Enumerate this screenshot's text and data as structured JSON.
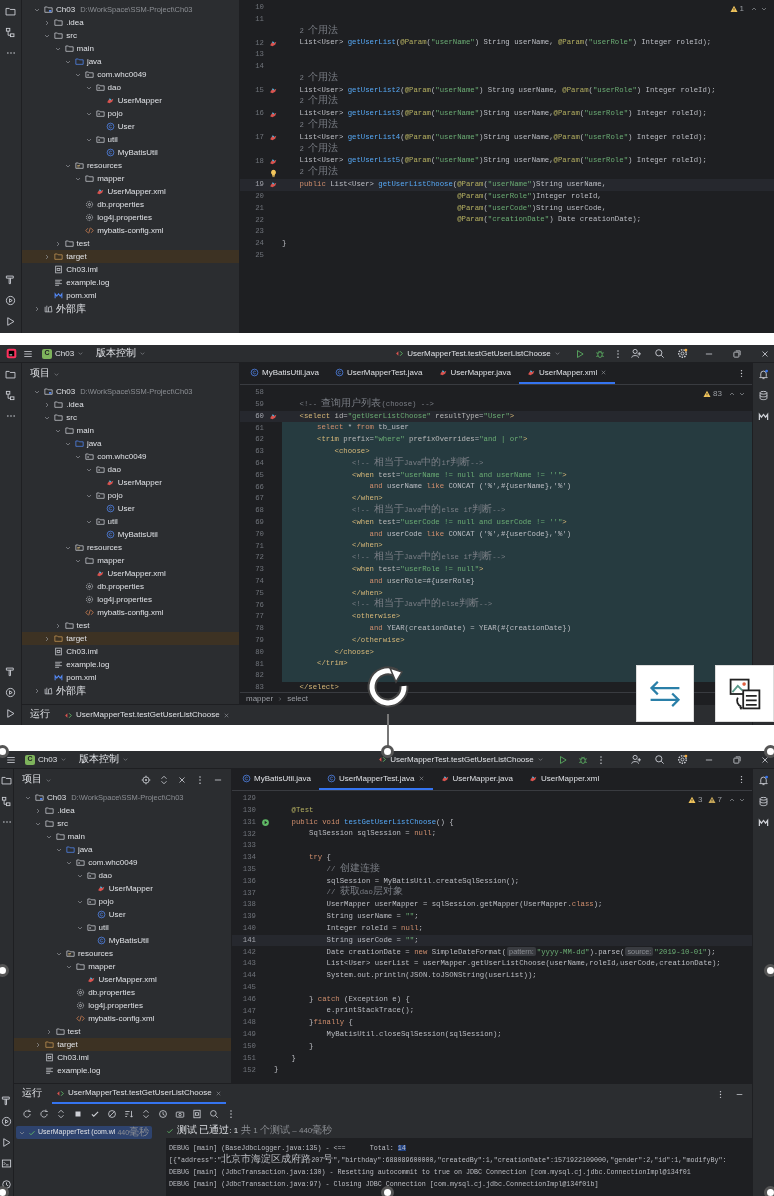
{
  "panels": [
    {
      "tree": [
        {
          "label": "Ch03",
          "path": "D:\\WorkSpace\\SSM-Project\\Ch03",
          "kind": "module",
          "expanded": true,
          "children": [
            {
              "label": ".idea",
              "kind": "folder",
              "expanded": false
            },
            {
              "label": "src",
              "kind": "folder",
              "expanded": true,
              "children": [
                {
                  "label": "main",
                  "kind": "folder",
                  "expanded": true,
                  "children": [
                    {
                      "label": "java",
                      "kind": "source-folder",
                      "expanded": true,
                      "children": [
                        {
                          "label": "com.whc0049",
                          "kind": "package",
                          "expanded": true,
                          "children": [
                            {
                              "label": "dao",
                              "kind": "package",
                              "expanded": true,
                              "children": [
                                {
                                  "label": "UserMapper",
                                  "kind": "mapper-interface"
                                }
                              ]
                            },
                            {
                              "label": "pojo",
                              "kind": "package",
                              "expanded": true,
                              "children": [
                                {
                                  "label": "User",
                                  "kind": "class"
                                }
                              ]
                            },
                            {
                              "label": "util",
                              "kind": "package",
                              "expanded": true,
                              "children": [
                                {
                                  "label": "MyBatisUtil",
                                  "kind": "class"
                                }
                              ]
                            }
                          ]
                        }
                      ]
                    },
                    {
                      "label": "resources",
                      "kind": "resources-folder",
                      "expanded": true,
                      "children": [
                        {
                          "label": "mapper",
                          "kind": "folder",
                          "expanded": true,
                          "children": [
                            {
                              "label": "UserMapper.xml",
                              "kind": "mapper-xml"
                            }
                          ]
                        },
                        {
                          "label": "db.properties",
                          "kind": "properties"
                        },
                        {
                          "label": "log4j.properties",
                          "kind": "properties"
                        },
                        {
                          "label": "mybatis-config.xml",
                          "kind": "xml"
                        }
                      ]
                    }
                  ]
                },
                {
                  "label": "test",
                  "kind": "folder",
                  "expanded": false
                }
              ]
            },
            {
              "label": "target",
              "kind": "excluded-folder",
              "expanded": false
            },
            {
              "label": "Ch03.iml",
              "kind": "iml"
            },
            {
              "label": "example.log",
              "kind": "log"
            },
            {
              "label": "pom.xml",
              "kind": "maven"
            }
          ]
        },
        {
          "label": "外部库",
          "kind": "library",
          "expanded": false
        }
      ],
      "editor": {
        "warnings": [
          {
            "kind": "warning",
            "count": "1"
          }
        ],
        "lines": [
          {
            "n": "10",
            "kind": "code"
          },
          {
            "n": "11",
            "kind": "code"
          },
          {
            "kind": "hint",
            "text": "    2 个用法"
          },
          {
            "n": "12",
            "kind": "code",
            "gutter": {
              "kind": "mapper"
            },
            "text": "    List<User> getUserList(@Param(\"userName\") String userName, @Param(\"userRole\") Integer roleId);"
          },
          {
            "n": "13",
            "kind": "code"
          },
          {
            "n": "14",
            "kind": "code"
          },
          {
            "kind": "hint",
            "text": "    2 个用法"
          },
          {
            "n": "15",
            "kind": "code",
            "gutter": {
              "kind": "mapper"
            },
            "text": "    List<User> getUserList2(@Param(\"userName\") String userName, @Param(\"userRole\") Integer roleId);"
          },
          {
            "kind": "hint",
            "text": "    2 个用法"
          },
          {
            "n": "16",
            "kind": "code",
            "gutter": {
              "kind": "mapper"
            },
            "text": "    List<User> getUserList3(@Param(\"userName\")String userName,@Param(\"userRole\") Integer roleId);"
          },
          {
            "kind": "hint",
            "text": "    2 个用法"
          },
          {
            "n": "17",
            "kind": "code",
            "gutter": {
              "kind": "mapper"
            },
            "text": "    List<User> getUserList4(@Param(\"userName\")String userName,@Param(\"userRole\") Integer roleId);"
          },
          {
            "kind": "hint",
            "text": "    2 个用法"
          },
          {
            "n": "18",
            "kind": "code",
            "gutter": {
              "kind": "mapper"
            },
            "text": "    List<User> getUserList5(@Param(\"userName\")String userName,@Param(\"userRole\") Integer roleId);"
          },
          {
            "kind": "hint",
            "gutter": {
              "kind": "bulb"
            },
            "text": "    2 个用法"
          },
          {
            "n": "19",
            "kind": "current",
            "gutter": {
              "kind": "mapper"
            },
            "text": "    public List<User> getUserListChoose(@Param(\"userName\")String userName,"
          },
          {
            "n": "20",
            "kind": "code",
            "text": "                                        @Param(\"userRole\")Integer roleId,"
          },
          {
            "n": "21",
            "kind": "code",
            "text": "                                        @Param(\"userCode\")String userCode,"
          },
          {
            "n": "22",
            "kind": "code",
            "text": "                                        @Param(\"creationDate\") Date creationDate);"
          },
          {
            "n": "23",
            "kind": "code"
          },
          {
            "n": "24",
            "kind": "code",
            "text": "}"
          },
          {
            "n": "25",
            "kind": "code"
          }
        ]
      }
    },
    {
      "titlebar": {
        "logo": true,
        "project_initial": "C",
        "project": "Ch03",
        "vcs": "版本控制",
        "run_config": "UserMapperTest.testGetUserListChoose"
      },
      "pane_title": "项目",
      "tree": [
        {
          "label": "Ch03",
          "path": "D:\\WorkSpace\\SSM-Project\\Ch03",
          "kind": "module",
          "expanded": true,
          "children": [
            {
              "label": ".idea",
              "kind": "folder",
              "expanded": false
            },
            {
              "label": "src",
              "kind": "folder",
              "expanded": true,
              "children": [
                {
                  "label": "main",
                  "kind": "folder",
                  "expanded": true,
                  "children": [
                    {
                      "label": "java",
                      "kind": "source-folder",
                      "expanded": true,
                      "children": [
                        {
                          "label": "com.whc0049",
                          "kind": "package",
                          "expanded": true,
                          "children": [
                            {
                              "label": "dao",
                              "kind": "package",
                              "expanded": true,
                              "children": [
                                {
                                  "label": "UserMapper",
                                  "kind": "mapper-interface"
                                }
                              ]
                            },
                            {
                              "label": "pojo",
                              "kind": "package",
                              "expanded": true,
                              "children": [
                                {
                                  "label": "User",
                                  "kind": "class"
                                }
                              ]
                            },
                            {
                              "label": "util",
                              "kind": "package",
                              "expanded": true,
                              "children": [
                                {
                                  "label": "MyBatisUtil",
                                  "kind": "class"
                                }
                              ]
                            }
                          ]
                        }
                      ]
                    },
                    {
                      "label": "resources",
                      "kind": "resources-folder",
                      "expanded": true,
                      "children": [
                        {
                          "label": "mapper",
                          "kind": "folder",
                          "expanded": true,
                          "children": [
                            {
                              "label": "UserMapper.xml",
                              "kind": "mapper-xml"
                            }
                          ]
                        },
                        {
                          "label": "db.properties",
                          "kind": "properties"
                        },
                        {
                          "label": "log4j.properties",
                          "kind": "properties"
                        },
                        {
                          "label": "mybatis-config.xml",
                          "kind": "xml"
                        }
                      ]
                    }
                  ]
                },
                {
                  "label": "test",
                  "kind": "folder",
                  "expanded": false
                }
              ]
            },
            {
              "label": "target",
              "kind": "excluded-folder",
              "expanded": false
            },
            {
              "label": "Ch03.iml",
              "kind": "iml"
            },
            {
              "label": "example.log",
              "kind": "log"
            },
            {
              "label": "pom.xml",
              "kind": "maven"
            }
          ]
        },
        {
          "label": "外部库",
          "kind": "library",
          "expanded": false
        }
      ],
      "editor": {
        "tabs": [
          {
            "label": "MyBatisUtil.java",
            "kind": "class",
            "selected": false
          },
          {
            "label": "UserMapperTest.java",
            "kind": "class",
            "selected": false
          },
          {
            "label": "UserMapper.java",
            "kind": "mapper-interface",
            "selected": false
          },
          {
            "label": "UserMapper.xml",
            "kind": "mapper-xml",
            "selected": true
          }
        ],
        "warnings": [
          {
            "kind": "warning",
            "count": "83"
          }
        ],
        "lines": [
          {
            "n": "58",
            "kind": "code"
          },
          {
            "n": "59",
            "kind": "code",
            "text": "    <!-- 查询用户列表(choose) -->"
          },
          {
            "n": "60",
            "kind": "current",
            "gutter": {
              "kind": "mapper"
            },
            "text": "    <select id=\"getUserListChoose\" resultType=\"User\">"
          },
          {
            "n": "61",
            "kind": "injected",
            "text": "        select * from tb_user"
          },
          {
            "n": "62",
            "kind": "injected",
            "text": "        <trim prefix=\"where\" prefixOverrides=\"and | or\">"
          },
          {
            "n": "63",
            "kind": "injected",
            "text": "            <choose>"
          },
          {
            "n": "64",
            "kind": "injected",
            "text": "                <!-- 相当于Java中的if判断-->"
          },
          {
            "n": "65",
            "kind": "injected",
            "text": "                <when test=\"userName != null and userName != ''\">"
          },
          {
            "n": "66",
            "kind": "injected",
            "text": "                    and userName like CONCAT ('%',#{userName},'%')"
          },
          {
            "n": "67",
            "kind": "injected",
            "text": "                </when>"
          },
          {
            "n": "68",
            "kind": "injected",
            "text": "                <!-- 相当于Java中的else if判断-->"
          },
          {
            "n": "69",
            "kind": "injected",
            "text": "                <when test=\"userCode != null and userCode != ''\">"
          },
          {
            "n": "70",
            "kind": "injected",
            "text": "                    and userCode like CONCAT ('%',#{userCode},'%')"
          },
          {
            "n": "71",
            "kind": "injected",
            "text": "                </when>"
          },
          {
            "n": "72",
            "kind": "injected",
            "text": "                <!-- 相当于Java中的else if判断-->"
          },
          {
            "n": "73",
            "kind": "injected",
            "text": "                <when test=\"userRole != null\">"
          },
          {
            "n": "74",
            "kind": "injected",
            "text": "                    and userRole=#{userRole}"
          },
          {
            "n": "75",
            "kind": "injected",
            "text": "                </when>"
          },
          {
            "n": "76",
            "kind": "injected",
            "text": "                <!-- 相当于Java中的else判断-->"
          },
          {
            "n": "77",
            "kind": "injected",
            "text": "                <otherwise>"
          },
          {
            "n": "78",
            "kind": "injected",
            "text": "                    and YEAR(creationDate) = YEAR(#{creationDate})"
          },
          {
            "n": "79",
            "kind": "injected",
            "text": "                </otherwise>"
          },
          {
            "n": "80",
            "kind": "injected",
            "text": "            </choose>"
          },
          {
            "n": "81",
            "kind": "injected",
            "text": "        </trim>"
          },
          {
            "n": "82",
            "kind": "injected"
          },
          {
            "n": "83",
            "kind": "code",
            "text": "    </select>"
          }
        ],
        "breadcrumb": [
          "mapper",
          "select"
        ]
      },
      "run": {
        "label": "运行",
        "tab": "UserMapperTest.testGetUserListChoose"
      }
    },
    {
      "titlebar": {
        "project_initial": "C",
        "project": "Ch03",
        "vcs": "版本控制",
        "run_config": "UserMapperTest.testGetUserListChoose"
      },
      "pane_title": "项目",
      "pane_tools": true,
      "tree": [
        {
          "label": "Ch03",
          "path": "D:\\WorkSpace\\SSM-Project\\Ch03",
          "kind": "module",
          "expanded": true,
          "children": [
            {
              "label": ".idea",
              "kind": "folder",
              "expanded": false
            },
            {
              "label": "src",
              "kind": "folder",
              "expanded": true,
              "children": [
                {
                  "label": "main",
                  "kind": "folder",
                  "expanded": true,
                  "children": [
                    {
                      "label": "java",
                      "kind": "source-folder",
                      "expanded": true,
                      "children": [
                        {
                          "label": "com.whc0049",
                          "kind": "package",
                          "expanded": true,
                          "children": [
                            {
                              "label": "dao",
                              "kind": "package",
                              "expanded": true,
                              "children": [
                                {
                                  "label": "UserMapper",
                                  "kind": "mapper-interface"
                                }
                              ]
                            },
                            {
                              "label": "pojo",
                              "kind": "package",
                              "expanded": true,
                              "children": [
                                {
                                  "label": "User",
                                  "kind": "class"
                                }
                              ]
                            },
                            {
                              "label": "util",
                              "kind": "package",
                              "expanded": true,
                              "children": [
                                {
                                  "label": "MyBatisUtil",
                                  "kind": "class"
                                }
                              ]
                            }
                          ]
                        }
                      ]
                    },
                    {
                      "label": "resources",
                      "kind": "resources-folder",
                      "expanded": true,
                      "children": [
                        {
                          "label": "mapper",
                          "kind": "folder",
                          "expanded": true,
                          "children": [
                            {
                              "label": "UserMapper.xml",
                              "kind": "mapper-xml"
                            }
                          ]
                        },
                        {
                          "label": "db.properties",
                          "kind": "properties"
                        },
                        {
                          "label": "log4j.properties",
                          "kind": "properties"
                        },
                        {
                          "label": "mybatis-config.xml",
                          "kind": "xml"
                        }
                      ]
                    }
                  ]
                },
                {
                  "label": "test",
                  "kind": "folder",
                  "expanded": false
                }
              ]
            },
            {
              "label": "target",
              "kind": "excluded-folder",
              "expanded": false
            },
            {
              "label": "Ch03.iml",
              "kind": "iml"
            },
            {
              "label": "example.log",
              "kind": "log"
            }
          ]
        }
      ],
      "editor": {
        "tabs": [
          {
            "label": "MyBatisUtil.java",
            "kind": "class",
            "selected": false
          },
          {
            "label": "UserMapperTest.java",
            "kind": "class",
            "selected": true
          },
          {
            "label": "UserMapper.java",
            "kind": "mapper-interface",
            "selected": false
          },
          {
            "label": "UserMapper.xml",
            "kind": "mapper-xml",
            "selected": false
          }
        ],
        "warnings": [
          {
            "kind": "warning",
            "count": "3"
          },
          {
            "kind": "weak-warning",
            "count": "7"
          }
        ],
        "lines": [
          {
            "n": "129",
            "kind": "code"
          },
          {
            "n": "130",
            "kind": "code",
            "text": "    @Test"
          },
          {
            "n": "131",
            "kind": "code",
            "gutter": {
              "kind": "run"
            },
            "text": "    public void testGetUserListChoose() {"
          },
          {
            "n": "132",
            "kind": "code",
            "text": "        SqlSession sqlSession = null;"
          },
          {
            "n": "133",
            "kind": "code"
          },
          {
            "n": "134",
            "kind": "code",
            "text": "        try {"
          },
          {
            "n": "135",
            "kind": "code",
            "text": "            // 创建连接"
          },
          {
            "n": "136",
            "kind": "code",
            "text": "            sqlSession = MyBatisUtil.createSqlSession();"
          },
          {
            "n": "137",
            "kind": "code",
            "text": "            // 获取dao层对象"
          },
          {
            "n": "138",
            "kind": "code",
            "text": "            UserMapper userMapper = sqlSession.getMapper(UserMapper.class);"
          },
          {
            "n": "139",
            "kind": "code",
            "text": "            String userName = \"\";"
          },
          {
            "n": "140",
            "kind": "code",
            "text": "            Integer roleId = null;"
          },
          {
            "n": "141",
            "kind": "current",
            "text": "            String userCode = \"\";"
          },
          {
            "n": "142",
            "kind": "code",
            "parts": [
              {
                "text": "            Date creationDate = new SimpleDateFormat("
              },
              {
                "inlay": "pattern:"
              },
              {
                "text": "\"yyyy-MM-dd\").parse("
              },
              {
                "inlay": "source:"
              },
              {
                "text": "\"2019-10-01\");"
              }
            ]
          },
          {
            "n": "143",
            "kind": "code",
            "text": "            List<User> userList = userMapper.getUserListChoose(userName,roleId,userCode,creationDate);"
          },
          {
            "n": "144",
            "kind": "code",
            "text": "            System.out.println(JSON.toJSONString(userList));"
          },
          {
            "n": "145",
            "kind": "code"
          },
          {
            "n": "146",
            "kind": "code",
            "text": "        } catch (Exception e) {"
          },
          {
            "n": "147",
            "kind": "code",
            "text": "            e.printStackTrace();"
          },
          {
            "n": "148",
            "kind": "code",
            "text": "        }finally {"
          },
          {
            "n": "149",
            "kind": "code",
            "text": "            MyBatisUtil.closeSqlSession(sqlSession);"
          },
          {
            "n": "150",
            "kind": "code",
            "text": "        }"
          },
          {
            "n": "151",
            "kind": "code",
            "text": "    }"
          },
          {
            "n": "152",
            "kind": "code",
            "text": "}"
          }
        ]
      },
      "run": {
        "label": "运行",
        "tab": "UserMapperTest.testGetUserListChoose",
        "tests": [
          {
            "label": "UserMapperTest (com.wl",
            "duration": "440毫秒",
            "passed": true,
            "expanded": true,
            "selected": true
          }
        ],
        "status": "测试 已通过: 1",
        "summary": "共 1 个测试 – 440毫秒",
        "console": [
          {
            "text": "DEBUG [main] (BaseJdbcLogger.java:135) - <==      Total: ",
            "highlight": "14"
          },
          {
            "text": "[{\"address\":\"北京市海淀区成府路207号\",\"birthday\":688089600000,\"createdBy\":1,\"creationDate\":1571922109000,\"gender\":2,\"id\":1,\"modifyBy\":"
          },
          {
            "text": "DEBUG [main] (JdbcTransaction.java:130) - Resetting autocommit to true on JDBC Connection [com.mysql.cj.jdbc.ConnectionImpl@134f01"
          },
          {
            "text": "DEBUG [main] (JdbcTransaction.java:97) - Closing JDBC Connection [com.mysql.cj.jdbc.ConnectionImpl@134f01b]"
          }
        ]
      }
    }
  ]
}
